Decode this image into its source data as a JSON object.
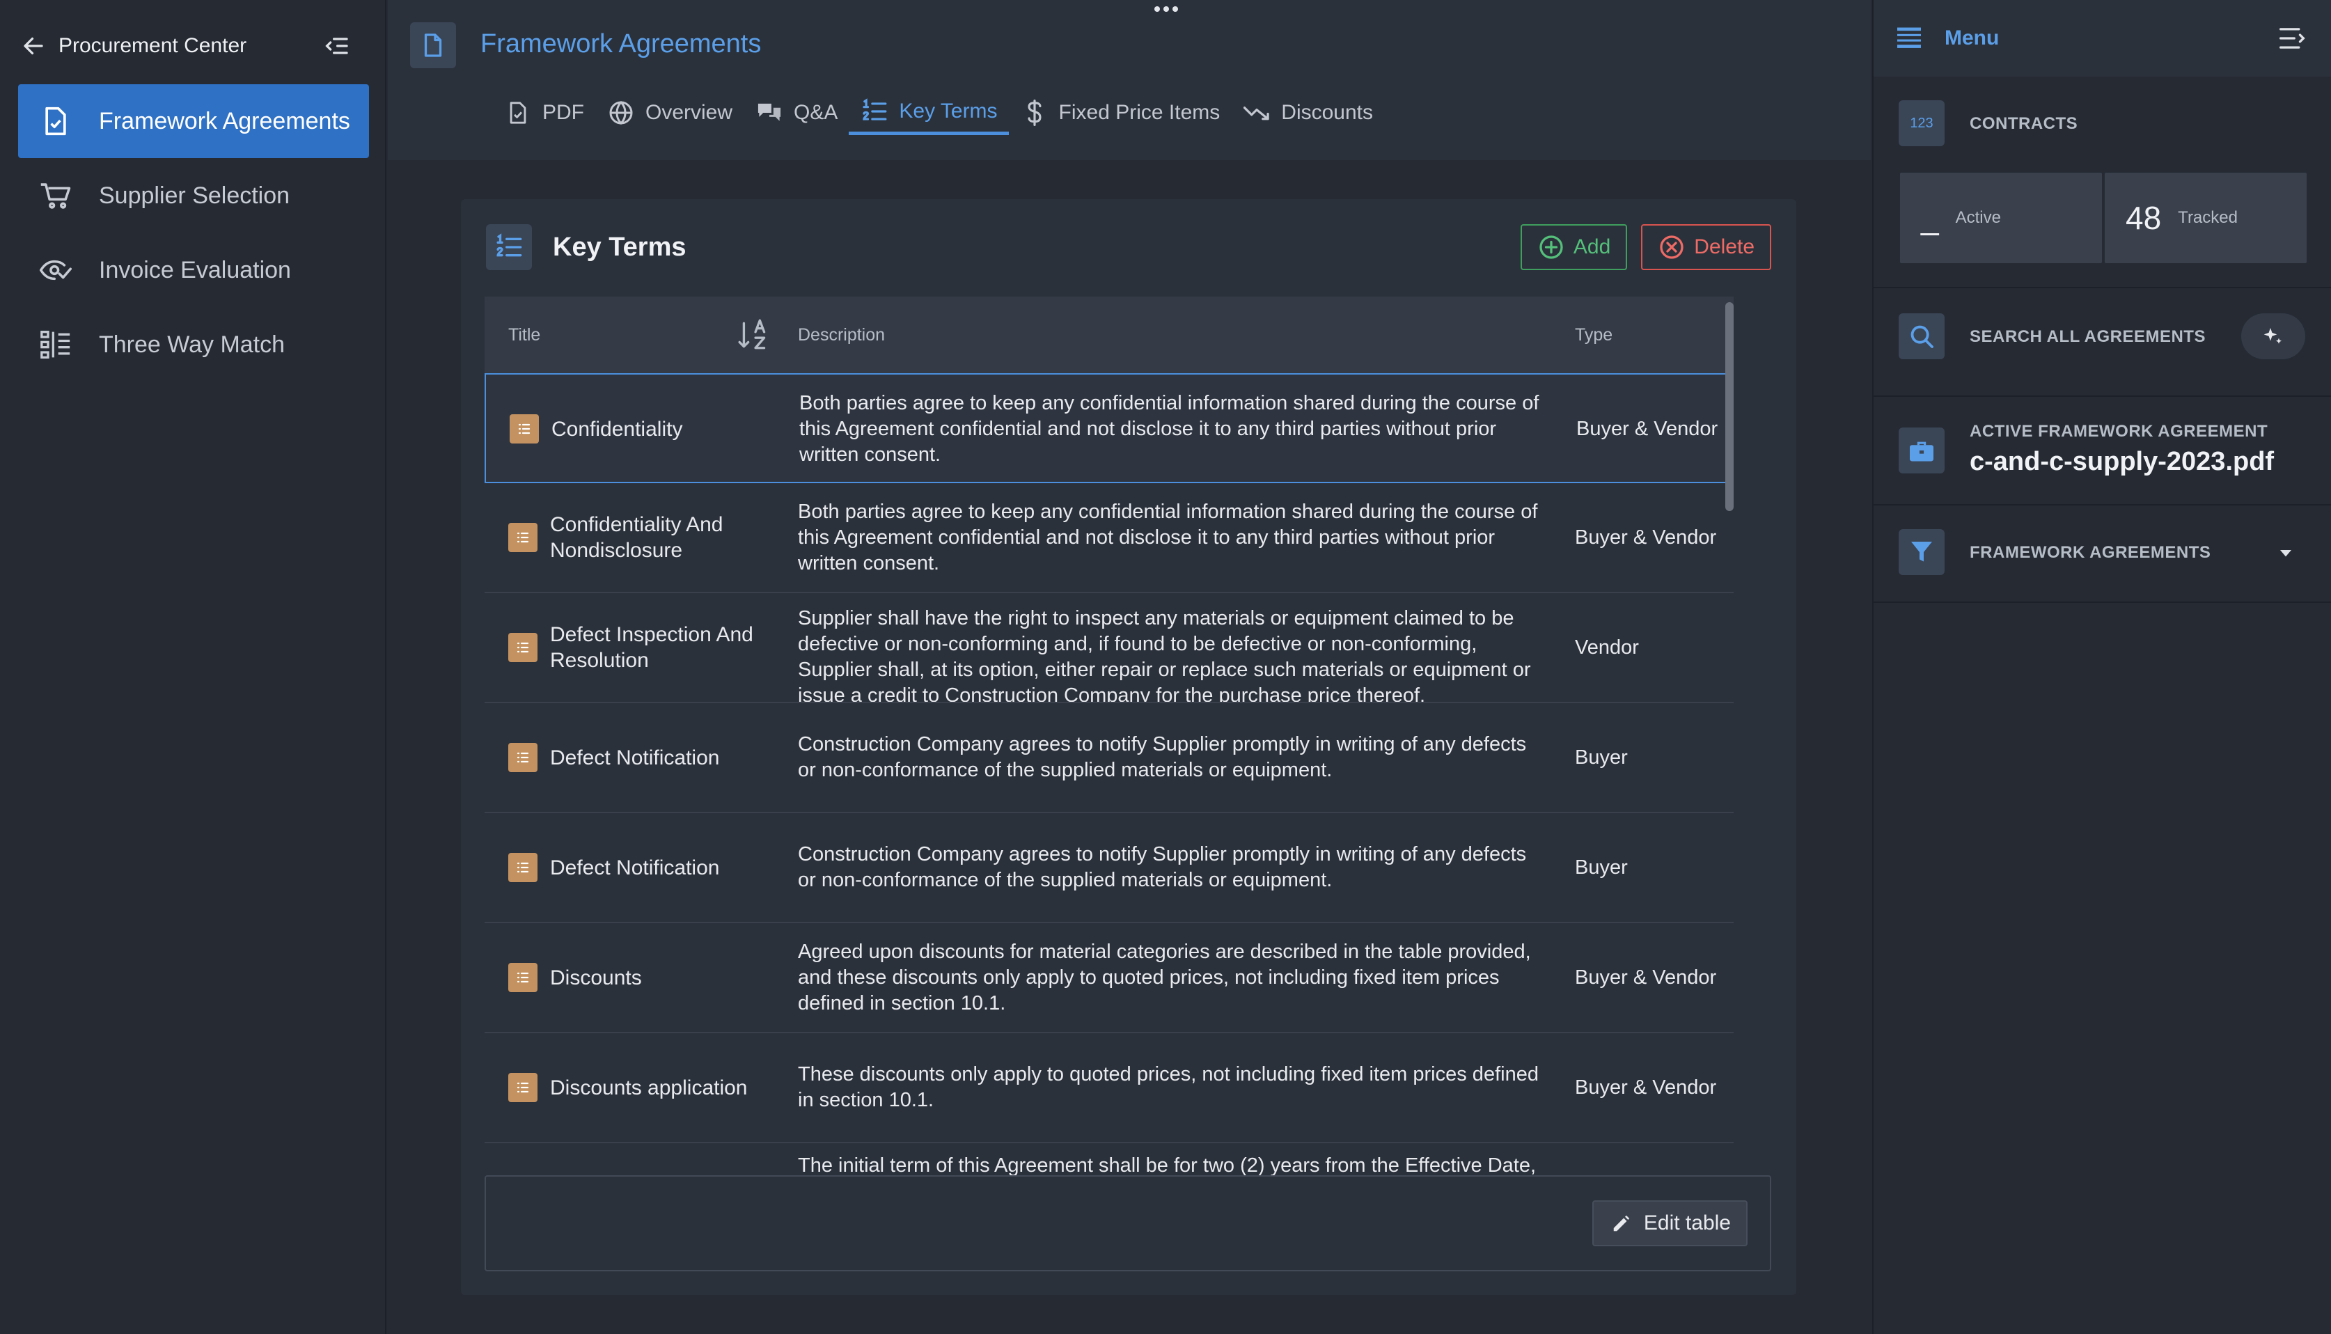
{
  "sidebar": {
    "title": "Procurement Center",
    "items": [
      {
        "label": "Framework Agreements",
        "icon": "document-check-icon",
        "active": true
      },
      {
        "label": "Supplier Selection",
        "icon": "cart-icon",
        "active": false
      },
      {
        "label": "Invoice Evaluation",
        "icon": "eye-check-icon",
        "active": false
      },
      {
        "label": "Three Way Match",
        "icon": "columns-list-icon",
        "active": false
      }
    ]
  },
  "header": {
    "title": "Framework Agreements",
    "tabs": [
      {
        "label": "PDF",
        "icon": "pdf-file-icon",
        "active": false
      },
      {
        "label": "Overview",
        "icon": "globe-icon",
        "active": false
      },
      {
        "label": "Q&A",
        "icon": "chat-bubbles-icon",
        "active": false
      },
      {
        "label": "Key Terms",
        "icon": "numbered-list-icon",
        "active": true
      },
      {
        "label": "Fixed Price Items",
        "icon": "dollar-icon",
        "active": false
      },
      {
        "label": "Discounts",
        "icon": "trend-down-icon",
        "active": false
      }
    ]
  },
  "panel": {
    "title": "Key Terms",
    "add_label": "Add",
    "delete_label": "Delete",
    "edit_label": "Edit table",
    "columns": {
      "title": "Title",
      "description": "Description",
      "type": "Type"
    },
    "rows": [
      {
        "title": "Confidentiality",
        "description": "Both parties agree to keep any confidential information shared during the course of this Agreement confidential and not disclose it to any third parties without prior written consent.",
        "type": "Buyer & Vendor",
        "selected": true
      },
      {
        "title": "Confidentiality And Nondisclosure",
        "description": "Both parties agree to keep any confidential information shared during the course of this Agreement confidential and not disclose it to any third parties without prior written consent.",
        "type": "Buyer & Vendor"
      },
      {
        "title": "Defect Inspection And Resolution",
        "description": "Supplier shall have the right to inspect any materials or equipment claimed to be defective or non-conforming and, if found to be defective or non-conforming, Supplier shall, at its option, either repair or replace such materials or equipment or issue a credit to Construction Company for the purchase price thereof.",
        "type": "Vendor"
      },
      {
        "title": "Defect Notification",
        "description": "Construction Company agrees to notify Supplier promptly in writing of any defects or non-conformance of the supplied materials or equipment.",
        "type": "Buyer"
      },
      {
        "title": "Defect Notification",
        "description": "Construction Company agrees to notify Supplier promptly in writing of any defects or non-conformance of the supplied materials or equipment.",
        "type": "Buyer"
      },
      {
        "title": "Discounts",
        "description": "Agreed upon discounts for material categories are described in the table provided, and these discounts only apply to quoted prices, not including fixed item prices defined in section 10.1.",
        "type": "Buyer & Vendor"
      },
      {
        "title": "Discounts application",
        "description": "These discounts only apply to quoted prices, not including fixed item prices defined in section 10.1.",
        "type": "Buyer & Vendor"
      },
      {
        "title": "",
        "description": "The initial term of this Agreement shall be for two (2) years from the Effective Date,",
        "type": ""
      }
    ]
  },
  "right_panel": {
    "menu_label": "Menu",
    "contracts": {
      "badge": "123",
      "caption": "CONTRACTS",
      "active_value": "_",
      "active_label": "Active",
      "tracked_value": "48",
      "tracked_label": "Tracked"
    },
    "search_label": "SEARCH ALL AGREEMENTS",
    "active_agreement": {
      "caption": "ACTIVE FRAMEWORK AGREEMENT",
      "name": "c-and-c-supply-2023.pdf"
    },
    "filter_label": "FRAMEWORK AGREEMENTS"
  },
  "colors": {
    "accent": "#5b9fe9",
    "active_item_bg": "#2f71c4",
    "add_green": "#54c07a",
    "delete_red": "#ee6b66",
    "row_icon": "#c49260",
    "background": "#252a33",
    "panel": "#2b313b"
  }
}
